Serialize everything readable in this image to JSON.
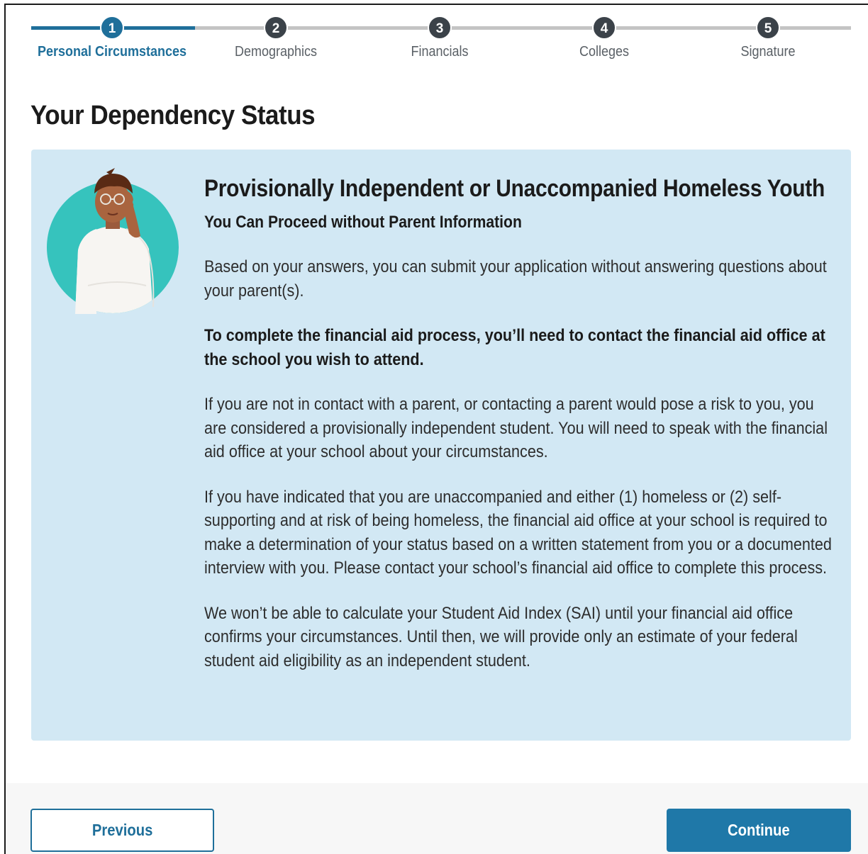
{
  "stepper": {
    "steps": [
      {
        "number": "1",
        "label": "Personal Circumstances"
      },
      {
        "number": "2",
        "label": "Demographics"
      },
      {
        "number": "3",
        "label": "Financials"
      },
      {
        "number": "4",
        "label": "Colleges"
      },
      {
        "number": "5",
        "label": "Signature"
      }
    ],
    "current_step": 1
  },
  "page": {
    "title": "Your Dependency Status"
  },
  "panel": {
    "heading": "Provisionally Independent or Unaccompanied Homeless Youth",
    "subheading": "You Can Proceed without Parent Information",
    "paragraphs": [
      "Based on your answers, you can submit your application without answering questions about your parent(s).",
      "To complete the financial aid process, you’ll need to contact the financial aid office at the school you wish to attend.",
      "If you are not in contact with a parent, or contacting a parent would pose a risk to you, you are considered a provisionally independent student. You will need to speak with the financial aid office at your school about your circumstances.",
      "If you have indicated that you are unaccompanied and either (1) homeless or (2) self-supporting and at risk of being homeless, the financial aid office at your school is required to make a determination of your status based on a written statement from you or a documented interview with you. Please contact your school’s financial aid office to complete this process.",
      "We won’t be able to calculate your Student Aid Index (SAI) until your financial aid office confirms your circumstances. Until then, we will provide only an estimate of your federal student aid eligibility as an independent student."
    ],
    "avatar_icon": "thinking-person-icon"
  },
  "footer": {
    "previous_label": "Previous",
    "continue_label": "Continue"
  },
  "colors": {
    "accent": "#1f6f9a",
    "panel_bg": "#d2e8f4",
    "step_inactive": "#3b4249",
    "avatar_circle": "#36c3bd"
  }
}
